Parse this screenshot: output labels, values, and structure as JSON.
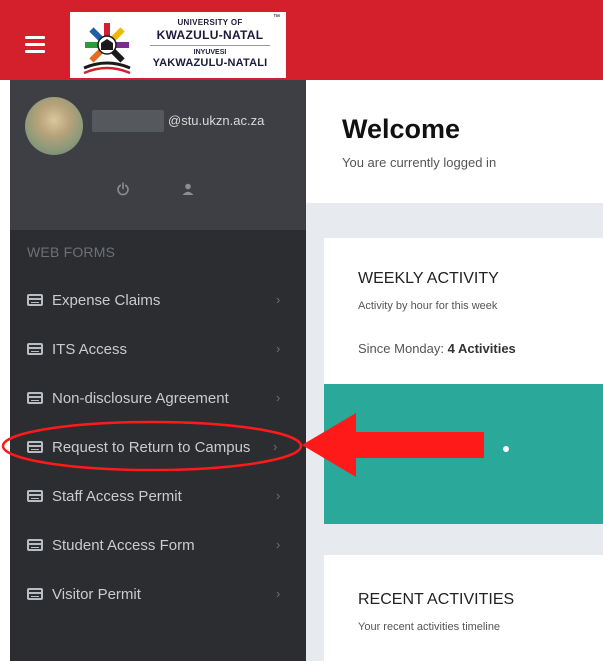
{
  "header": {
    "logo": {
      "line1": "UNIVERSITY OF",
      "line2": "KWAZULU-NATAL",
      "line3": "INYUVESI",
      "line4": "YAKWAZULU-NATALI",
      "tm": "™"
    }
  },
  "profile": {
    "email_suffix": "@stu.ukzn.ac.za"
  },
  "sidebar": {
    "section_label": "WEB FORMS",
    "items": [
      {
        "label": "Expense Claims"
      },
      {
        "label": "ITS Access"
      },
      {
        "label": "Non-disclosure Agreement"
      },
      {
        "label": "Request to Return to Campus"
      },
      {
        "label": "Staff Access Permit"
      },
      {
        "label": "Student Access Form"
      },
      {
        "label": "Visitor Permit"
      }
    ],
    "chevron": "›"
  },
  "welcome": {
    "title": "Welcome",
    "subtitle": "You are currently logged in"
  },
  "weekly": {
    "title": "WEEKLY ACTIVITY",
    "subtitle": "Activity by hour for this week",
    "since_label": "Since Monday:",
    "since_value": "4 Activities"
  },
  "recent": {
    "title": "RECENT ACTIVITIES",
    "subtitle": "Your recent activities timeline"
  },
  "colors": {
    "brand_red": "#d4202c",
    "sidebar_bg": "#2b2d31",
    "profile_bg": "#3d3f44",
    "teal": "#2aa89a",
    "annotation_red": "#ff1a1a"
  }
}
